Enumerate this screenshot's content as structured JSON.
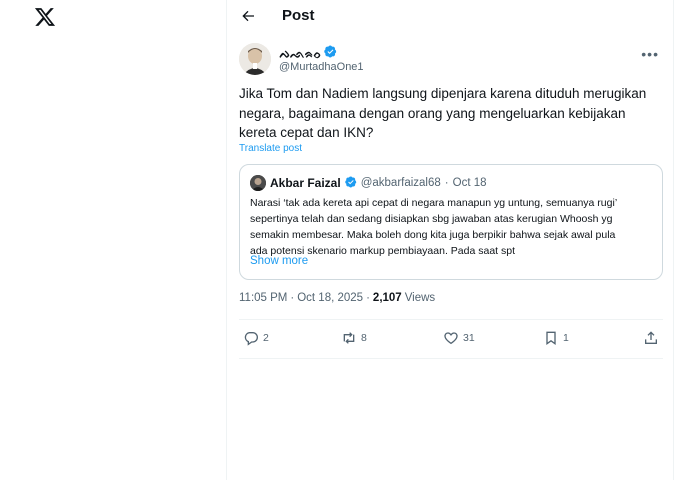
{
  "header": {
    "title": "Post"
  },
  "tweet": {
    "display_name": "ᨄᨒᨑᨔ",
    "handle": "@MurtadhaOne1",
    "text": "Jika Tom dan Nadiem langsung dipenjara karena dituduh merugikan negara, bagaimana dengan orang yang mengeluarkan kebijakan kereta cepat dan IKN?",
    "translate_label": "Translate post",
    "time": "11:05 PM",
    "date": "Oct 18, 2025",
    "views_count": "2,107",
    "views_label": "Views",
    "verified": true
  },
  "quote": {
    "name": "Akbar Faizal",
    "handle": "@akbarfaizal68",
    "separator": "·",
    "date": "Oct 18",
    "lines": [
      "Narasi ‘tak ada kereta api cepat di negara manapun yg untung, semuanya rugi’",
      "sepertinya telah dan sedang disiapkan sbg jawaban atas kerugian Whoosh yg",
      "semakin membesar. Maka boleh dong kita juga berpikir bahwa sejak awal pula",
      "ada potensi skenario markup pembiayaan. Pada saat spt"
    ],
    "show_more": "Show more"
  },
  "actions": {
    "replies": "2",
    "reposts": "8",
    "likes": "31",
    "bookmarks": "1"
  },
  "colors": {
    "accent": "#1d9bf0",
    "secondary_text": "#536471",
    "border": "#cfd9de"
  }
}
